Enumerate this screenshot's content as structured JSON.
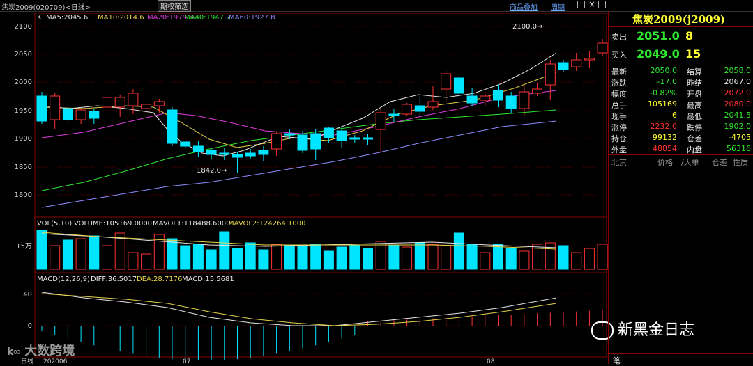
{
  "topbar": {
    "symbol_info": "焦炭2009(020709)<日线>",
    "filter_tab": "期权筛选",
    "overlay_link": "商品叠加",
    "period_link": "周期"
  },
  "main_chart": {
    "ma_labels": [
      {
        "text": "K",
        "color": "#e6e6e6"
      },
      {
        "text": "MA5:2045.6",
        "color": "#e6e6e6"
      },
      {
        "text": "MA10:2014.6",
        "color": "#e6d44a"
      },
      {
        "text": "MA20:1979.8",
        "color": "#e03ce0"
      },
      {
        "text": "MA40:1947.7",
        "color": "#2ee82e"
      },
      {
        "text": "MA60:1927.8",
        "color": "#8c8cff"
      }
    ],
    "y_ticks": [
      "2100",
      "2050",
      "2000",
      "1950",
      "1900",
      "1850",
      "1800"
    ],
    "high_note": "2100.0→",
    "low_note": "1842.0→"
  },
  "volume_chart": {
    "labels": [
      {
        "text": "VOL(5,10)",
        "color": "#e6e6e6"
      },
      {
        "text": "VOLUME:105169.0000",
        "color": "#e6e6e6"
      },
      {
        "text": "MAVOL1:118488.6000",
        "color": "#e6e6e6"
      },
      {
        "text": "MAVOL2:124264.1000",
        "color": "#e6d44a"
      }
    ],
    "y_tick": "15万"
  },
  "macd_chart": {
    "labels": [
      {
        "text": "MACD(12,26,9)",
        "color": "#e6e6e6"
      },
      {
        "text": "DIFF:36.5017",
        "color": "#e6e6e6"
      },
      {
        "text": "DEA:28.7176",
        "color": "#e6d44a"
      },
      {
        "text": "MACD:15.5681",
        "color": "#e6e6e6"
      }
    ],
    "y_ticks": [
      "40",
      "0"
    ]
  },
  "x_axis": {
    "mode_label": "日线",
    "ticks": [
      "202006",
      "07",
      "08"
    ]
  },
  "watermarks": {
    "left_brand": "大数跨境",
    "right_brand": "新黑金日志"
  },
  "quote_panel": {
    "title": "焦炭2009(j2009)",
    "sell_label": "卖出",
    "sell_price": "2051.0",
    "sell_qty": "8",
    "buy_label": "买入",
    "buy_price": "2049.0",
    "buy_qty": "15",
    "rows": [
      {
        "l1": "最新",
        "v1": "2050.0",
        "c1": "green",
        "l2": "结算",
        "v2": "2058.0",
        "c2": "green"
      },
      {
        "l1": "涨跌",
        "v1": "-17.0",
        "c1": "green",
        "l2": "昨结",
        "v2": "2067.0",
        "c2": "white"
      },
      {
        "l1": "幅度",
        "v1": "-0.82%",
        "c1": "green",
        "l2": "开盘",
        "v2": "2072.0",
        "c2": "red"
      },
      {
        "l1": "总手",
        "v1": "105169",
        "c1": "yellow",
        "l2": "最高",
        "v2": "2080.0",
        "c2": "red"
      },
      {
        "l1": "现手",
        "v1": "6",
        "c1": "yellow",
        "l2": "最低",
        "v2": "2041.5",
        "c2": "green"
      },
      {
        "l1": "涨停",
        "v1": "2232.0",
        "c1": "red",
        "l2": "跌停",
        "v2": "1902.0",
        "c2": "green"
      },
      {
        "l1": "持仓",
        "v1": "99132",
        "c1": "yellow",
        "l2": "仓差",
        "v2": "-4705",
        "c2": "yellow"
      },
      {
        "l1": "外盘",
        "v1": "48854",
        "c1": "red",
        "l2": "内盘",
        "v2": "56316",
        "c2": "green"
      }
    ],
    "tick_header": [
      "北京",
      "价格",
      "/大单",
      "仓差",
      "性质"
    ],
    "footer_label": "笔"
  }
}
